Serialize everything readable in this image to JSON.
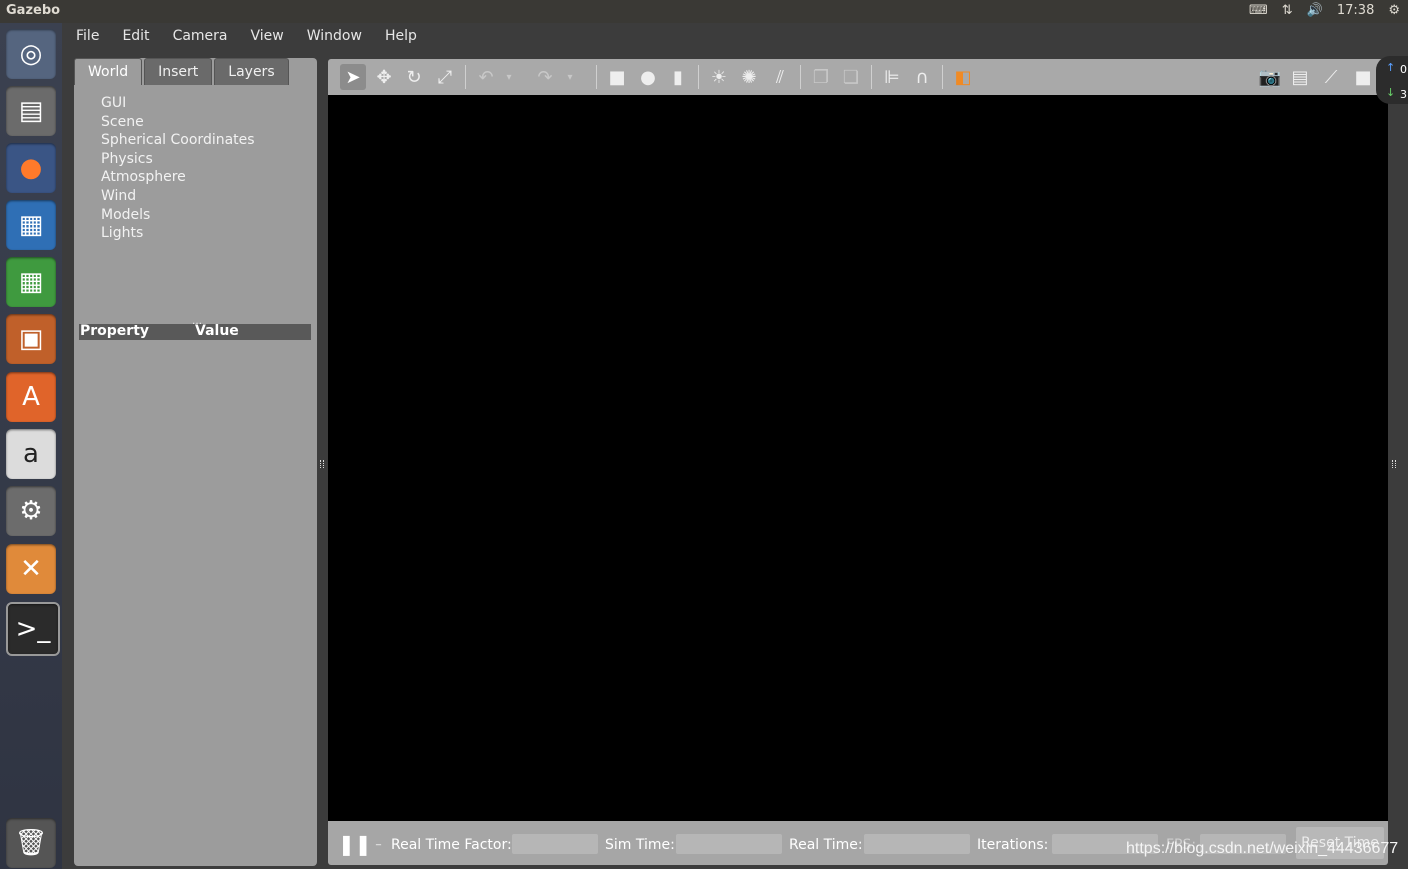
{
  "system_bar": {
    "app_title": "Gazebo",
    "clock": "17:38",
    "icons": [
      "keyboard-icon",
      "network-icon",
      "volume-icon",
      "settings-gear-icon"
    ]
  },
  "launcher": {
    "items": [
      "ubuntu-dash-icon",
      "files-icon",
      "firefox-icon",
      "writer-icon",
      "calc-icon",
      "impress-icon",
      "software-center-icon",
      "amazon-icon",
      "system-settings-icon",
      "gazebo-icon",
      "terminal-icon",
      "trash-icon"
    ]
  },
  "menubar": [
    "File",
    "Edit",
    "Camera",
    "View",
    "Window",
    "Help"
  ],
  "left_panel": {
    "tabs": [
      "World",
      "Insert",
      "Layers"
    ],
    "active_tab": "World",
    "tree_items": [
      "GUI",
      "Scene",
      "Spherical Coordinates",
      "Physics",
      "Atmosphere",
      "Wind",
      "Models",
      "Lights"
    ],
    "property_header": {
      "property": "Property",
      "value": "Value"
    }
  },
  "toolbar": {
    "tools": [
      "select-arrow-icon",
      "translate-icon",
      "rotate-icon",
      "scale-icon",
      "undo-icon",
      "undo-dropdown-icon",
      "redo-icon",
      "redo-dropdown-icon",
      "box-icon",
      "sphere-icon",
      "cylinder-icon",
      "point-light-icon",
      "spot-light-icon",
      "directional-light-icon",
      "copy-icon",
      "paste-icon",
      "align-icon",
      "snap-icon",
      "view-angle-icon",
      "screenshot-icon",
      "log-icon",
      "plot-icon",
      "video-record-icon"
    ]
  },
  "bottom_bar": {
    "real_time_factor_label": "Real Time Factor:",
    "sim_time_label": "Sim Time:",
    "real_time_label": "Real Time:",
    "iterations_label": "Iterations:",
    "fps_label": "FPS:",
    "reset_button": "Reset Time"
  },
  "right_edge": {
    "top": "0",
    "bottom": "3"
  },
  "watermark": "https://blog.csdn.net/weixin_44436677"
}
